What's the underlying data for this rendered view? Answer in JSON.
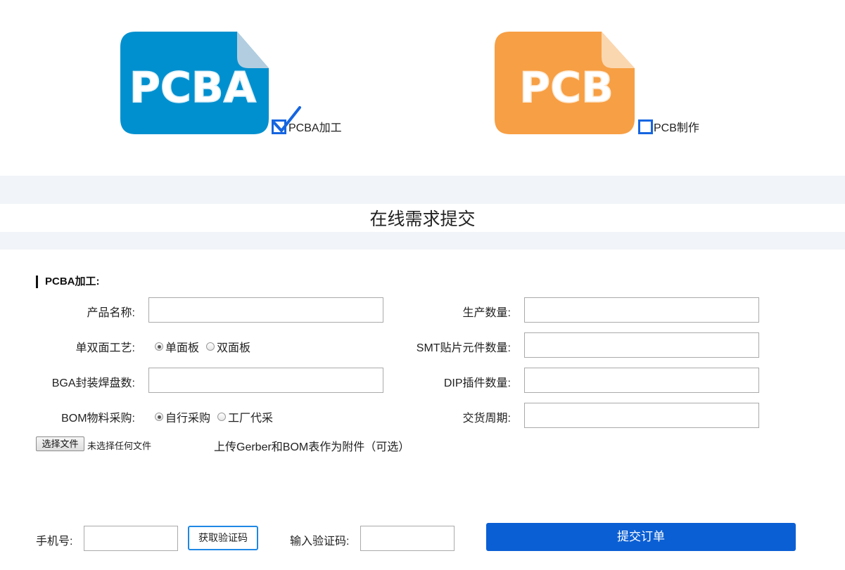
{
  "services": [
    {
      "logo_text": "PCBA",
      "label": "PCBA加工",
      "checked": true,
      "color": "#0090cf",
      "fold_color": "#b3cde0"
    },
    {
      "logo_text": "PCB",
      "label": "PCB制作",
      "checked": false,
      "color": "#f79f44",
      "fold_color": "#fbd7b0"
    }
  ],
  "section_title": "在线需求提交",
  "form": {
    "group_title": "PCBA加工:",
    "product_name": {
      "label": "产品名称:",
      "value": ""
    },
    "quantity": {
      "label": "生产数量:",
      "value": ""
    },
    "process": {
      "label": "单双面工艺:",
      "options": [
        "单面板",
        "双面板"
      ],
      "selected": 0
    },
    "smt_count": {
      "label": "SMT贴片元件数量:",
      "value": ""
    },
    "bga_count": {
      "label": "BGA封装焊盘数:",
      "value": ""
    },
    "dip_count": {
      "label": "DIP插件数量:",
      "value": ""
    },
    "bom": {
      "label": "BOM物料采购:",
      "options": [
        "自行采购",
        "工厂代采"
      ],
      "selected": 0
    },
    "delivery": {
      "label": "交货周期:",
      "value": ""
    },
    "file_button": "选择文件",
    "file_status": "未选择任何文件",
    "upload_hint": "上传Gerber和BOM表作为附件（可选）",
    "phone": {
      "label": "手机号:",
      "value": ""
    },
    "sms_button": "获取验证码",
    "code": {
      "label": "输入验证码:",
      "value": ""
    },
    "submit": "提交订单"
  }
}
